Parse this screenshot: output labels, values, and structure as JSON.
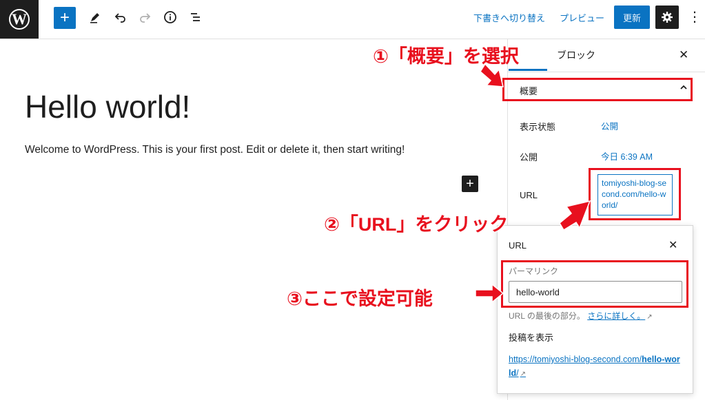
{
  "toolbar": {
    "wp_logo": "W",
    "add": "+",
    "icons": [
      "pencil-icon",
      "undo-icon",
      "redo-icon",
      "info-icon",
      "list-view-icon"
    ],
    "switch_draft": "下書きへ切り替え",
    "preview": "プレビュー",
    "update": "更新",
    "accent_color": "#0a73c2"
  },
  "editor": {
    "title": "Hello world!",
    "body": "Welcome to WordPress. This is your first post. Edit or delete it, then start writing!",
    "block_add": "+"
  },
  "sidebar": {
    "tab_block": "ブロック",
    "panel_title": "概要",
    "rows": [
      {
        "label": "表示状態",
        "value": "公開"
      },
      {
        "label": "公開",
        "value": "今日 6:39 AM"
      },
      {
        "label": "URL",
        "value": "tomiyoshi-blog-second.com/hello-world/"
      }
    ]
  },
  "popover": {
    "title": "URL",
    "permalink_label": "パーマリンク",
    "permalink_value": "hello-world",
    "help_text": "URL の最後の部分。",
    "help_link": "さらに詳しく。",
    "view_label": "投稿を表示",
    "view_url_prefix": "https://tomiyoshi-blog-second.com/",
    "view_url_slug": "hello-world",
    "view_url_suffix": "/"
  },
  "annotations": {
    "step1": "①「概要」を選択",
    "step2": "②「URL」をクリック",
    "step3": "③ここで設定可能",
    "color": "#e8101e"
  }
}
